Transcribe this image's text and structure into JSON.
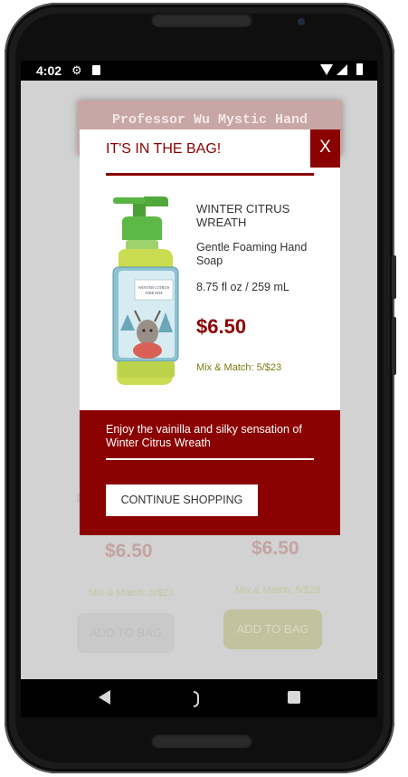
{
  "status_bar": {
    "time": "4:02",
    "icons": [
      "gear-icon",
      "sd-card-icon",
      "wifi-icon",
      "signal-icon",
      "battery-icon"
    ]
  },
  "background_page": {
    "title": "Professor Wu Mystic Hand",
    "price_1": "$6.50",
    "price_2": "$6.50",
    "mix_1": "Mix & Match: 5/$23",
    "mix_2": "Mix & Match: 5/$23",
    "add_to_bag_1": "ADD TO BAG",
    "add_to_bag_2": "ADD TO BAG"
  },
  "modal": {
    "title": "IT'S IN THE BAG!",
    "close_label": "X",
    "product": {
      "name": "WINTER CITRUS WREATH",
      "description": "Gentle Foaming Hand Soap",
      "size": "8.75 fl oz / 259 mL",
      "price": "$6.50",
      "promo": "Mix & Match: 5/$23",
      "label_text": "WINTER CITRUS WREATH"
    },
    "promo_text": "Enjoy the vainilla and silky sensation of Winter Citrus Wreath",
    "continue_label": "CONTINUE SHOPPING"
  },
  "colors": {
    "brand": "#8b0000",
    "overlay": "#d2d2d2",
    "mix_match": "#7a7a10"
  },
  "nav_bar": {
    "icons": [
      "back-icon",
      "home-icon",
      "recents-icon"
    ]
  }
}
